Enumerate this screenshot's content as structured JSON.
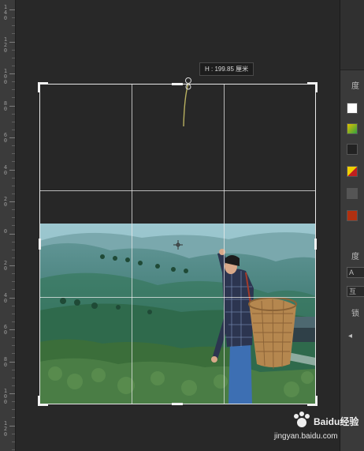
{
  "ruler": {
    "labels": [
      {
        "text": "140"
      },
      {
        "text": "120"
      },
      {
        "text": "100"
      },
      {
        "text": "80"
      },
      {
        "text": "60"
      },
      {
        "text": "40"
      },
      {
        "text": "20"
      },
      {
        "text": "0"
      },
      {
        "text": "20"
      },
      {
        "text": "40"
      },
      {
        "text": "60"
      },
      {
        "text": "80"
      },
      {
        "text": "100"
      },
      {
        "text": "120"
      }
    ]
  },
  "tooltip": {
    "text": "H : 199.85 厘米"
  },
  "panel": {
    "letters": [
      "度",
      "A",
      "互",
      "锁"
    ]
  },
  "watermark": {
    "brand": "Baidu经验",
    "url": "jingyan.baidu.com"
  }
}
